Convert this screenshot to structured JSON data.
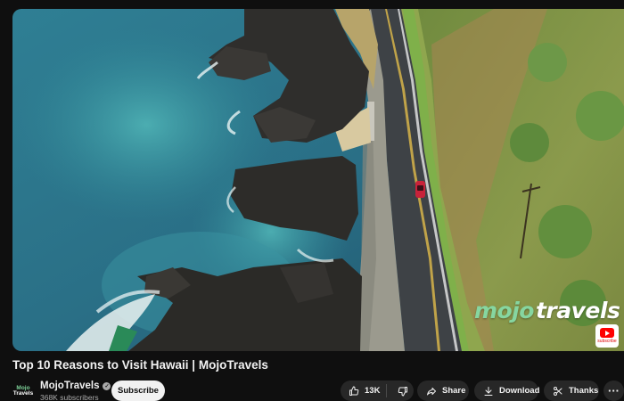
{
  "video": {
    "title": "Top 10 Reasons to Visit Hawaii | MojoTravels",
    "watermark": {
      "part1": "mojo",
      "part2": "travels"
    },
    "subscribe_badge": "subscribe"
  },
  "channel": {
    "avatar_line1": "Mojo",
    "avatar_line2": "Travels",
    "name": "MojoTravels",
    "verified_mark": "✓",
    "subscribers": "368K subscribers"
  },
  "actions": {
    "subscribe": "Subscribe",
    "likes": "13K",
    "share": "Share",
    "download": "Download",
    "thanks": "Thanks",
    "more": "···"
  },
  "icons": {
    "like": "thumbs-up-icon",
    "dislike": "thumbs-down-icon",
    "share": "share-arrow-icon",
    "download": "download-arrow-icon",
    "thanks": "scissors-heart-icon",
    "more": "more-horizontal-icon",
    "verified": "verified-check-icon"
  },
  "colors": {
    "background": "#0f0f0f",
    "pill": "#272727",
    "subscribe_bg": "#f1f1f1",
    "watermark_green": "#86d6a0",
    "badge_red": "#ff0000"
  }
}
